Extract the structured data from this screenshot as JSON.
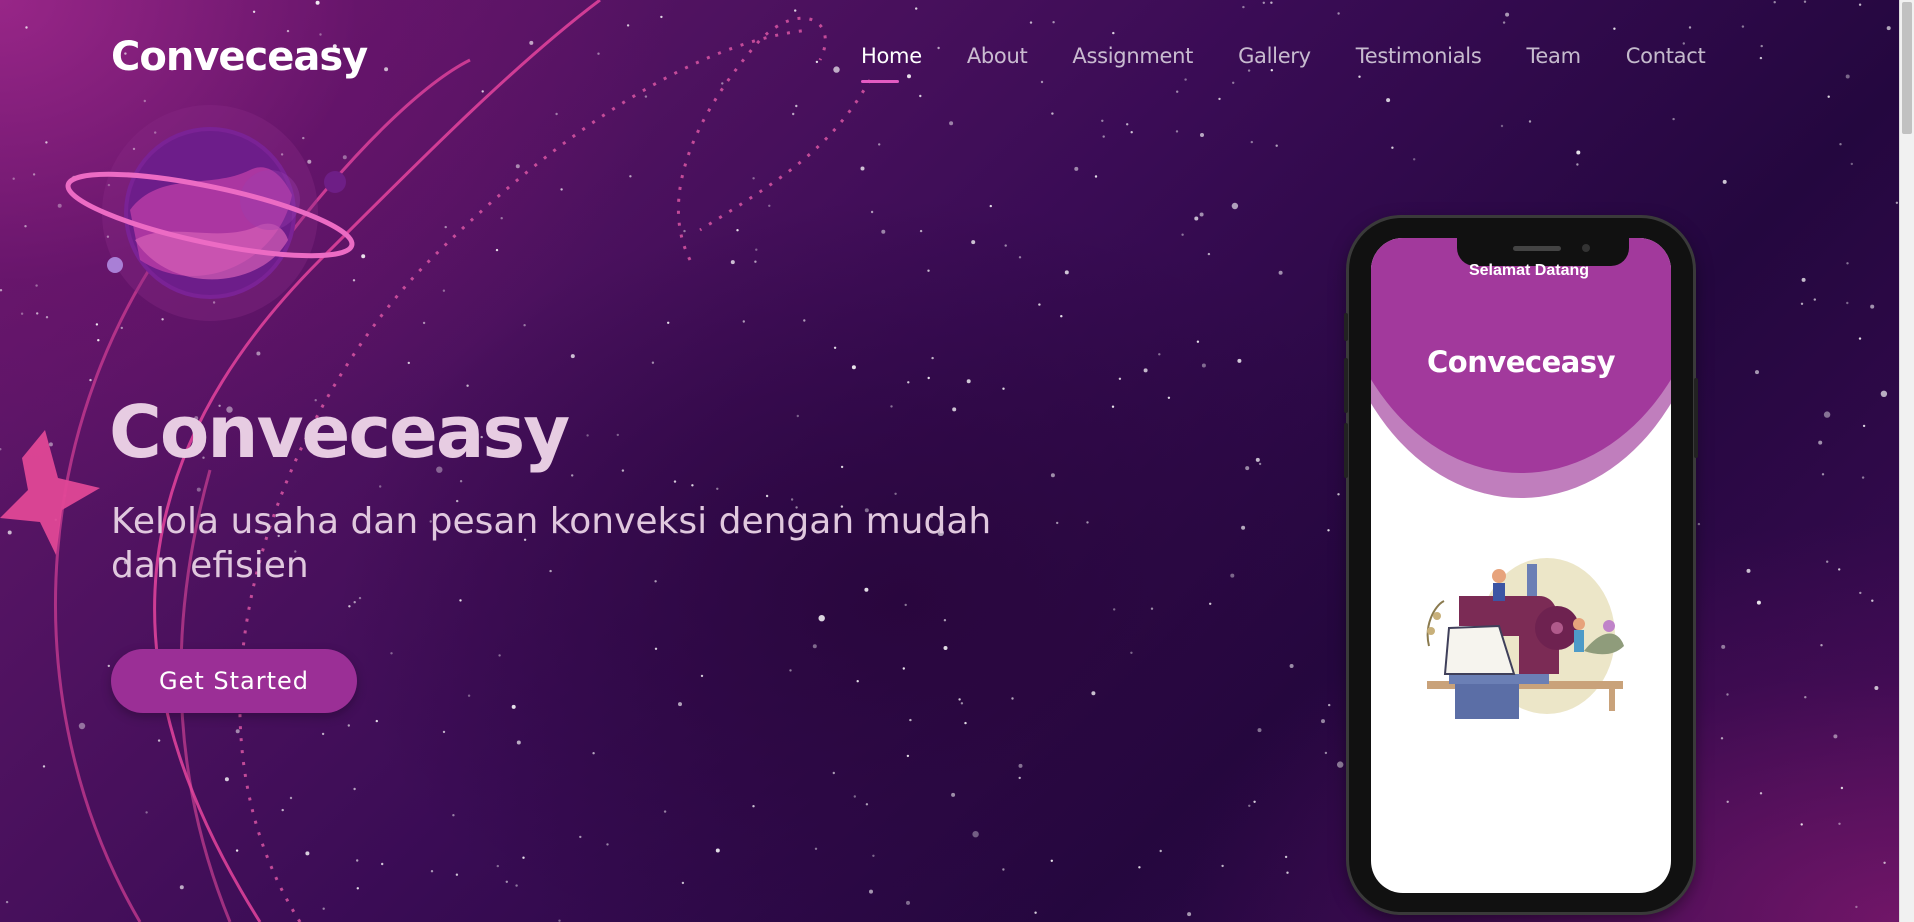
{
  "header": {
    "logo": "Conveceasy"
  },
  "nav": {
    "items": [
      {
        "label": "Home",
        "active": true
      },
      {
        "label": "About"
      },
      {
        "label": "Assignment"
      },
      {
        "label": "Gallery"
      },
      {
        "label": "Testimonials"
      },
      {
        "label": "Team"
      },
      {
        "label": "Contact"
      }
    ]
  },
  "hero": {
    "title": "Conveceasy",
    "subtitle": "Kelola usaha dan pesan konveksi dengan mudah dan efisien",
    "cta_label": "Get Started"
  },
  "phone": {
    "welcome": "Selamat Datang",
    "app_name": "Conveceasy",
    "illustration": "sewing-machine-illustration"
  },
  "colors": {
    "accent": "#9b2f96",
    "nav_underline": "#e35bc3",
    "phone_header": "#a2399c"
  }
}
